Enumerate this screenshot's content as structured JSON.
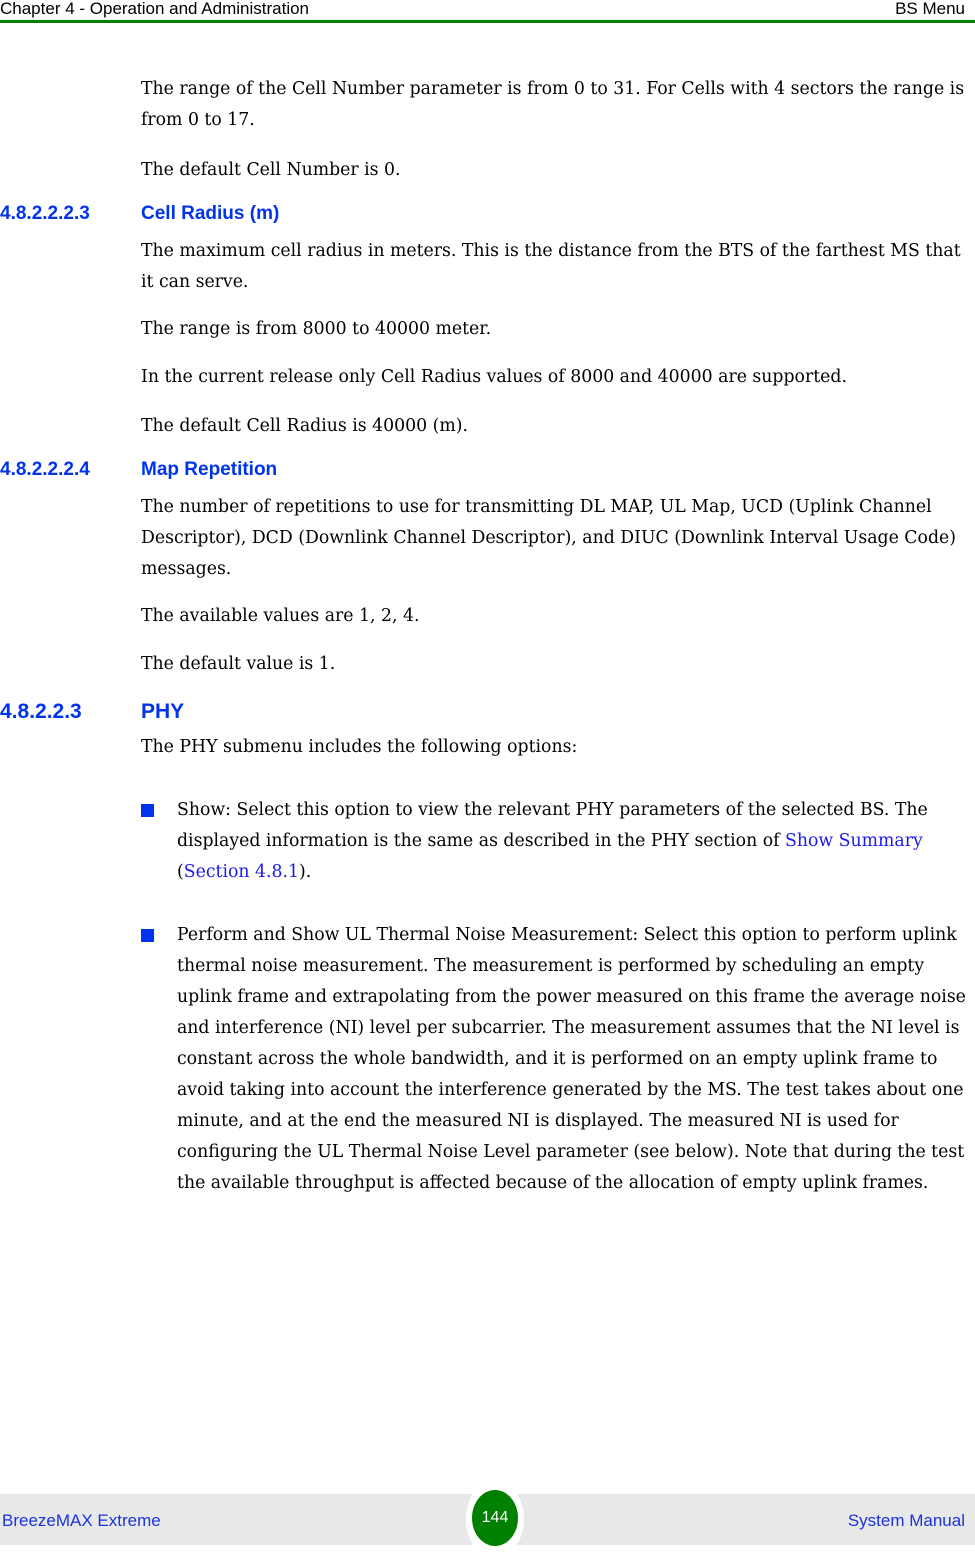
{
  "header": {
    "chapter": "Chapter 4 - Operation and Administration",
    "section": "BS Menu",
    "rule_color": "#008000"
  },
  "content": {
    "intro_para1": "The range of the Cell Number parameter is from 0 to 31. For Cells with 4 sectors the range is from 0 to 17.",
    "intro_para2": "The default Cell Number is 0.",
    "sections": [
      {
        "number": "4.8.2.2.2.3",
        "title": "Cell Radius (m)",
        "paragraphs": [
          "The maximum cell radius in meters. This is the distance from the BTS of the farthest MS that it can serve.",
          "The range is from 8000 to 40000 meter.",
          "In the current release only Cell Radius values of 8000 and 40000 are supported.",
          "The default Cell Radius is 40000 (m)."
        ]
      },
      {
        "number": "4.8.2.2.2.4",
        "title": "Map Repetition",
        "paragraphs": [
          "The number of repetitions to use for transmitting DL MAP, UL Map, UCD (Uplink Channel Descriptor), DCD (Downlink Channel Descriptor), and DIUC (Downlink Interval Usage Code) messages.",
          "The available values are 1, 2, 4.",
          "The default value is 1."
        ]
      },
      {
        "number": "4.8.2.2.3",
        "title": "PHY",
        "paragraphs": [
          "The PHY submenu includes the following options:"
        ],
        "bullets": [
          {
            "text": "Show: Select this option to view the relevant PHY parameters of the selected BS. The displayed information is the same as described in the PHY section of ",
            "link1": "Show Summary",
            "mid": " (",
            "link2": "Section 4.8.1",
            "end": ")."
          },
          {
            "text": "Perform and Show UL Thermal Noise Measurement: Select this option to perform uplink thermal noise measurement. The measurement is performed by scheduling an empty uplink frame and extrapolating from the power measured on this frame the average noise and interference (NI) level per subcarrier. The measurement assumes that the NI level is constant across the whole bandwidth, and it is performed on an empty uplink frame to avoid taking into account the interference generated by the MS. The test takes about one minute, and at the end the measured NI is displayed. The measured NI is used for configuring the UL Thermal Noise Level parameter (see below). Note that during the test the available throughput is affected because of the allocation of empty uplink frames."
          }
        ]
      }
    ]
  },
  "footer": {
    "product": "BreezeMAX Extreme",
    "page_number": "144",
    "doc_type": "System Manual"
  }
}
